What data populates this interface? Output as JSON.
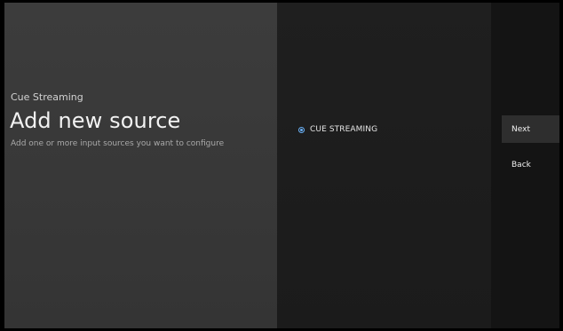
{
  "guidance": {
    "breadcrumb": "Cue Streaming",
    "title": "Add new source",
    "description": "Add one or more input sources you want to configure"
  },
  "sources": {
    "options": [
      {
        "label": "CUE STREAMING",
        "selected": true
      }
    ]
  },
  "actions": {
    "next_label": "Next",
    "back_label": "Back"
  },
  "colors": {
    "accent": "#6ab0f5",
    "guidance_panel": "#3a3a3a",
    "list_panel": "#1d1d1d",
    "actions_panel": "#141414",
    "focused_action": "#2e2e2e"
  }
}
